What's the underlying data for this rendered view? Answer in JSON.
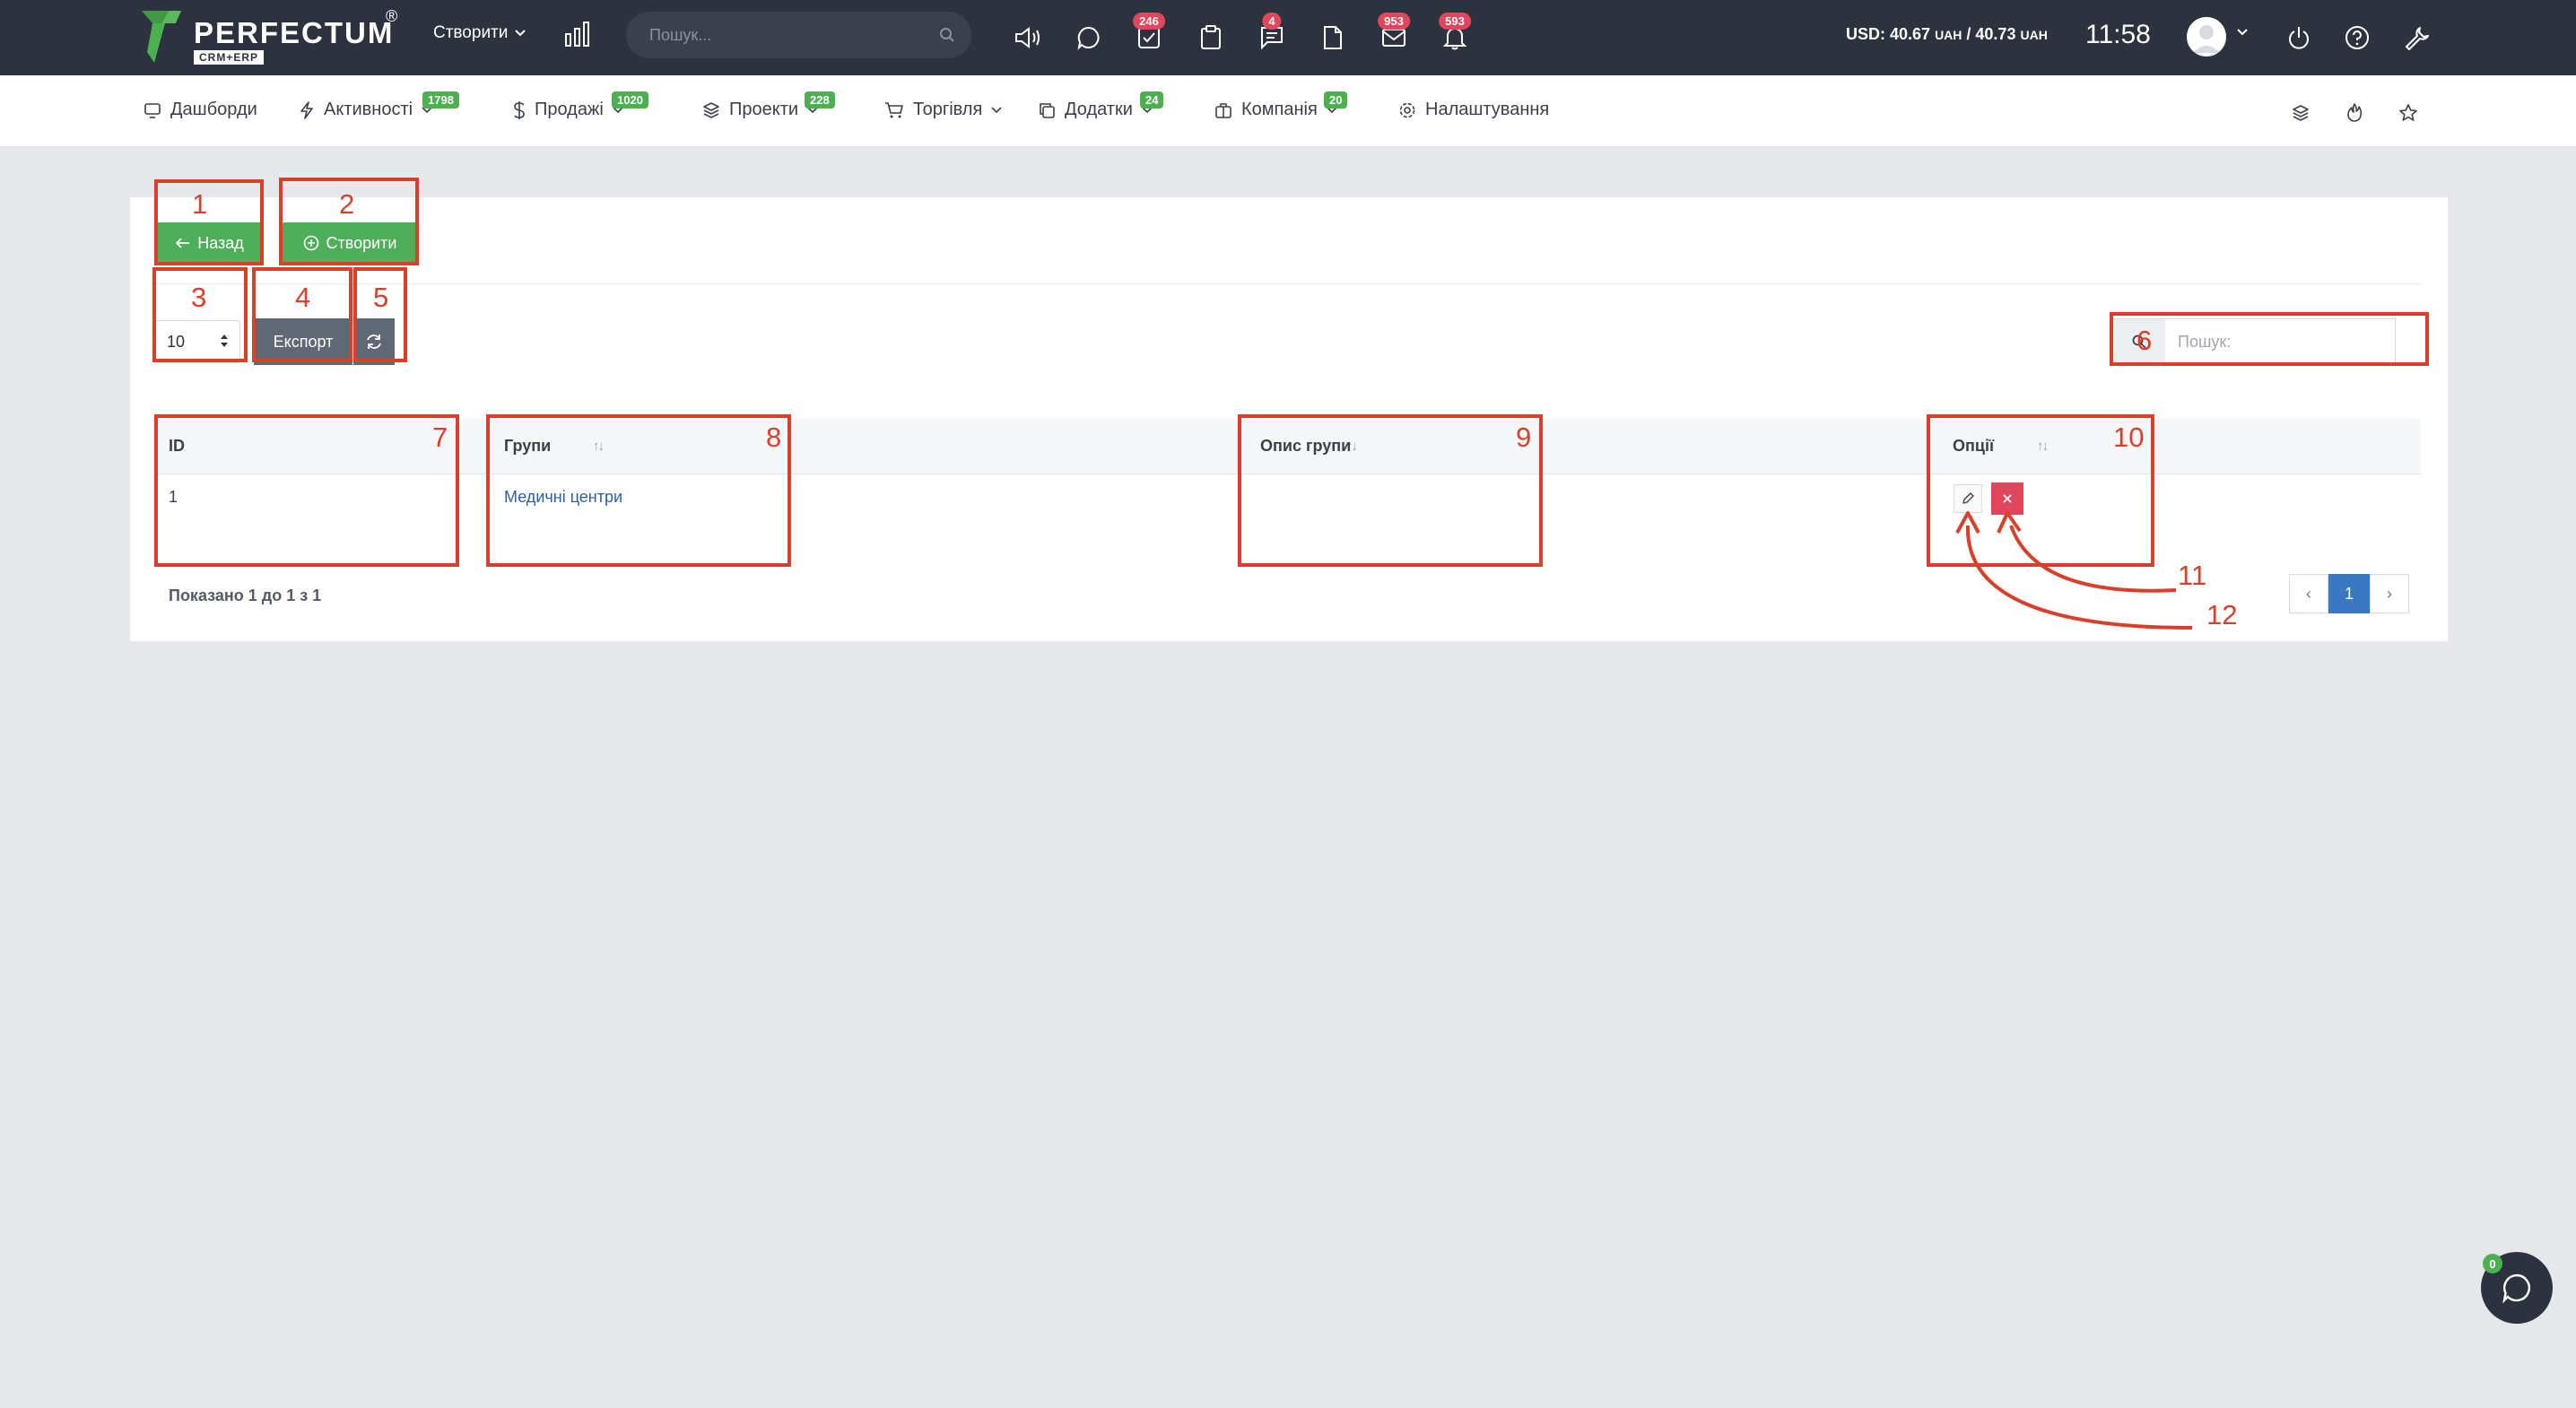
{
  "topbar": {
    "logo_text": "PERFECTUM",
    "logo_reg": "®",
    "logo_sub": "CRM+ERP",
    "create_label": "Створити",
    "search_placeholder": "Пошук...",
    "badges": {
      "tasks": "246",
      "messages": "4",
      "mail": "953",
      "notifications": "593"
    },
    "currency_prefix": "USD: 40.67",
    "currency_unit1": "UAH",
    "currency_mid": " / 40.73",
    "currency_unit2": "UAH",
    "time": "11:58"
  },
  "nav": {
    "items": [
      {
        "label": "Дашборди",
        "icon": "monitor-icon"
      },
      {
        "label": "Активності",
        "icon": "lightning-icon",
        "badge": "1798"
      },
      {
        "label": "Продажі",
        "icon": "dollar-icon",
        "badge": "1020"
      },
      {
        "label": "Проекти",
        "icon": "layers-icon",
        "badge": "228"
      },
      {
        "label": "Торгівля",
        "icon": "cart-icon"
      },
      {
        "label": "Додатки",
        "icon": "copy-icon",
        "badge": "24"
      },
      {
        "label": "Компанія",
        "icon": "briefcase-icon",
        "badge": "20"
      },
      {
        "label": "Налаштування",
        "icon": "gear-icon"
      }
    ]
  },
  "page": {
    "back_label": "Назад",
    "create_label": "Створити",
    "page_length": "10",
    "export_label": "Експорт",
    "search_placeholder": "Пошук:",
    "columns": [
      "ID",
      "Групи",
      "Опис групи",
      "Опції"
    ],
    "rows": [
      {
        "id": "1",
        "group": "Медичні центри",
        "description": ""
      }
    ],
    "info": "Показано 1 до 1 з 1",
    "pagination": {
      "prev": "‹",
      "current": "1",
      "next": "›"
    }
  },
  "annotations": [
    "1",
    "2",
    "3",
    "4",
    "5",
    "6",
    "7",
    "8",
    "9",
    "10",
    "11",
    "12"
  ],
  "chat": {
    "badge": "0"
  },
  "colors": {
    "topbar": "#2d333e",
    "green": "#4fae59",
    "red_badge": "#e0475c",
    "annotation": "#d9402b",
    "link": "#2c5fa8",
    "pager_active": "#3a78c2"
  }
}
